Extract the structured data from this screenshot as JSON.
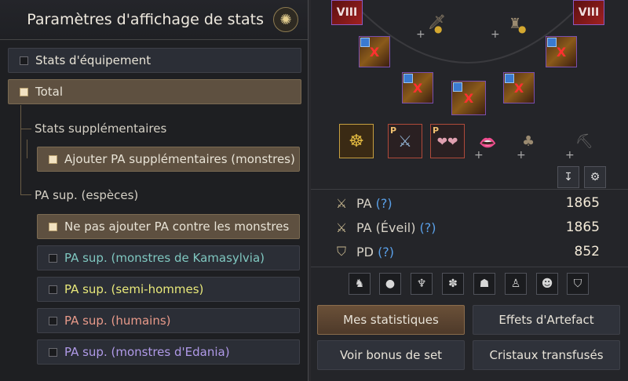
{
  "left_panel": {
    "title": "Paramètres d'affichage de stats",
    "title_icon": "star-gear-icon",
    "equip_stats_label": "Stats d'équipement",
    "total_label": "Total",
    "extra_stats_heading": "Stats supplémentaires",
    "add_ap_monsters_label": "Ajouter PA supplémentaires (monstres)",
    "species_heading": "PA sup. (espèces)",
    "species_options": [
      {
        "label": "Ne pas ajouter PA contre les monstres",
        "color": "#e8e3d6",
        "selected": true
      },
      {
        "label": "PA sup. (monstres de Kamasylvia)",
        "color": "#7fc7c0",
        "selected": false
      },
      {
        "label": "PA sup. (semi-hommes)",
        "color": "#e8e87a",
        "selected": false
      },
      {
        "label": "PA sup. (humains)",
        "color": "#e89a8a",
        "selected": false
      },
      {
        "label": "PA sup. (monstres d'Edania)",
        "color": "#b09ae8",
        "selected": false
      }
    ]
  },
  "right_panel": {
    "slot_badges": [
      "VIII",
      "VIII"
    ],
    "slot_marker": "X",
    "p_badge": "P",
    "stats": [
      {
        "icon": "sword-icon",
        "label": "PA",
        "q": "(?)",
        "value": "1865"
      },
      {
        "icon": "awakening-sword-icon",
        "label": "PA (Éveil)",
        "q": "(?)",
        "value": "1865"
      },
      {
        "icon": "shield-icon",
        "label": "PD",
        "q": "(?)",
        "value": "852"
      }
    ],
    "race_icons": [
      "beast-icon",
      "mask-icon",
      "demon-icon",
      "paw-icon",
      "ogre-icon",
      "humanoid-icon",
      "human-icon",
      "shield-crest-icon"
    ],
    "buttons": {
      "my_stats": "Mes statistiques",
      "artifact_effects": "Effets d'Artefact",
      "set_bonus": "Voir bonus de set",
      "transfused_crystals": "Cristaux transfusés"
    }
  }
}
